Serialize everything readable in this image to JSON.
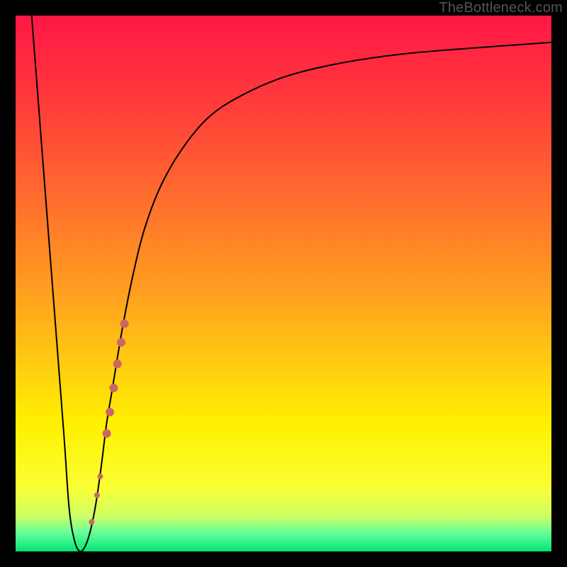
{
  "watermark": {
    "text": "TheBottleneck.com"
  },
  "colors": {
    "stops": [
      {
        "offset": 0.0,
        "color": "#ff1846"
      },
      {
        "offset": 0.16,
        "color": "#ff3a3a"
      },
      {
        "offset": 0.33,
        "color": "#ff6a2f"
      },
      {
        "offset": 0.5,
        "color": "#ff9a20"
      },
      {
        "offset": 0.66,
        "color": "#ffcf10"
      },
      {
        "offset": 0.76,
        "color": "#fff000"
      },
      {
        "offset": 0.88,
        "color": "#faff33"
      },
      {
        "offset": 0.935,
        "color": "#ccff66"
      },
      {
        "offset": 0.965,
        "color": "#66ff99"
      },
      {
        "offset": 1.0,
        "color": "#00e676"
      }
    ],
    "curve_stroke": "#000000",
    "marker_fill": "#cc6666",
    "frame": "#000000"
  },
  "chart_data": {
    "type": "line",
    "title": "",
    "xlabel": "",
    "ylabel": "",
    "xlim": [
      0,
      100
    ],
    "ylim": [
      0,
      100
    ],
    "series": [
      {
        "name": "bottleneck-curve",
        "x": [
          3,
          5,
          7,
          9,
          10,
          11,
          12,
          13,
          14,
          15,
          16,
          17,
          18,
          20,
          22,
          24,
          27,
          31,
          36,
          42,
          50,
          60,
          72,
          86,
          100
        ],
        "y": [
          100,
          74,
          48,
          22,
          8,
          2,
          0,
          1,
          4,
          9,
          16,
          24,
          30,
          42,
          52,
          60,
          68,
          75,
          81,
          85,
          88.5,
          91,
          92.8,
          94,
          95
        ]
      }
    ],
    "markers": [
      {
        "x": 14.2,
        "y": 5.5,
        "r": 4
      },
      {
        "x": 15.2,
        "y": 10.5,
        "r": 4
      },
      {
        "x": 15.8,
        "y": 14.0,
        "r": 4
      },
      {
        "x": 17.0,
        "y": 22.0,
        "r": 6
      },
      {
        "x": 17.6,
        "y": 26.0,
        "r": 6
      },
      {
        "x": 18.3,
        "y": 30.5,
        "r": 6
      },
      {
        "x": 19.0,
        "y": 35.0,
        "r": 6
      },
      {
        "x": 19.7,
        "y": 39.0,
        "r": 6
      },
      {
        "x": 20.3,
        "y": 42.5,
        "r": 6
      }
    ]
  }
}
